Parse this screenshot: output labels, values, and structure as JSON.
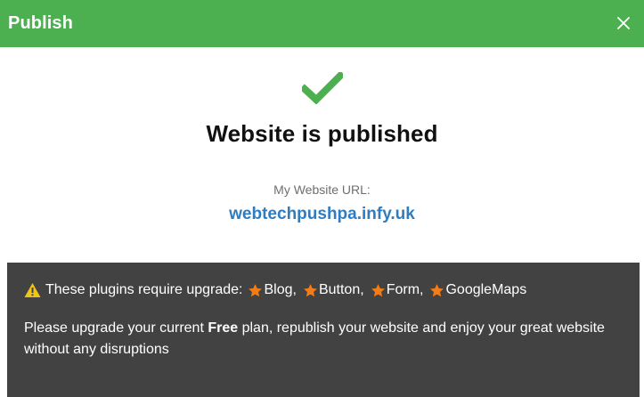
{
  "header": {
    "title": "Publish",
    "close_icon": "close-icon",
    "background_color": "#4caf50"
  },
  "status": {
    "icon": "checkmark-icon",
    "icon_color": "#4caf50",
    "heading": "Website is published"
  },
  "url": {
    "label": "My Website URL:",
    "value": "webtechpushpa.infy.uk",
    "color": "#2f7cc0"
  },
  "notice": {
    "warning_icon": "warning-icon",
    "warning_color": "#f0c419",
    "star_color": "#f57c14",
    "intro": "These plugins require upgrade:",
    "plugins": [
      {
        "name": "Blog",
        "icon": "star-icon"
      },
      {
        "name": "Button",
        "icon": "star-icon"
      },
      {
        "name": "Form",
        "icon": "star-icon"
      },
      {
        "name": "GoogleMaps",
        "icon": "star-icon"
      }
    ],
    "message_before": "Please upgrade your current ",
    "plan_name": "Free",
    "message_after": " plan, republish your website and enjoy your great website without any disruptions",
    "background_color": "#424242"
  }
}
